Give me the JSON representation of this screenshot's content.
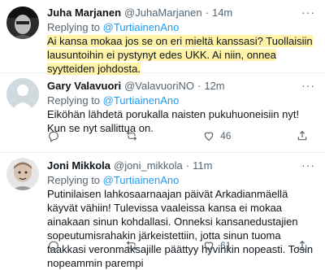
{
  "tweets": [
    {
      "name": "Juha Marjanen",
      "handle": "@JuhaMarjanen",
      "time": "14m",
      "reply_prefix": "Replying to",
      "reply_to": "@TurtiainenAno",
      "text": "Ai kansa mokaa jos se on eri mieltä kanssasi? Tuollaisiin lausuntoihin ei pystynyt edes UKK. Ai niin, onnea syytteiden johdosta.",
      "likes": ""
    },
    {
      "name": "Gary Valavuori",
      "handle": "@ValavuoriNO",
      "time": "12m",
      "reply_prefix": "Replying to",
      "reply_to": "@TurtiainenAno",
      "text": "Eiköhän lähdetä porukalla naisten pukuhuoneisiin nyt! Kun se nyt sallittua on.",
      "likes": "46"
    },
    {
      "name": "Joni Mikkola",
      "handle": "@joni_mikkola",
      "time": "11m",
      "reply_prefix": "Replying to",
      "reply_to": "@TurtiainenAno",
      "text": "Putinilaisen lahkosaarnaajan päivät Arkadianmäellä käyvät vähiin! Tulevissa vaaleissa kansa ei mokaa ainakaan sinun kohdallasi. Onneksi kansanedustajien sopeutumisrahakin järkeistettiin, jotta sinun tuoma taakkasi veronmaksajille päättyy hyvinkin nopeasti. Tosin nopeammin parempi",
      "likes": "61"
    }
  ],
  "separator": "·",
  "more": "···",
  "colors": {
    "link": "#1d9bf0",
    "muted": "#536471",
    "highlight": "#fff3a8"
  }
}
